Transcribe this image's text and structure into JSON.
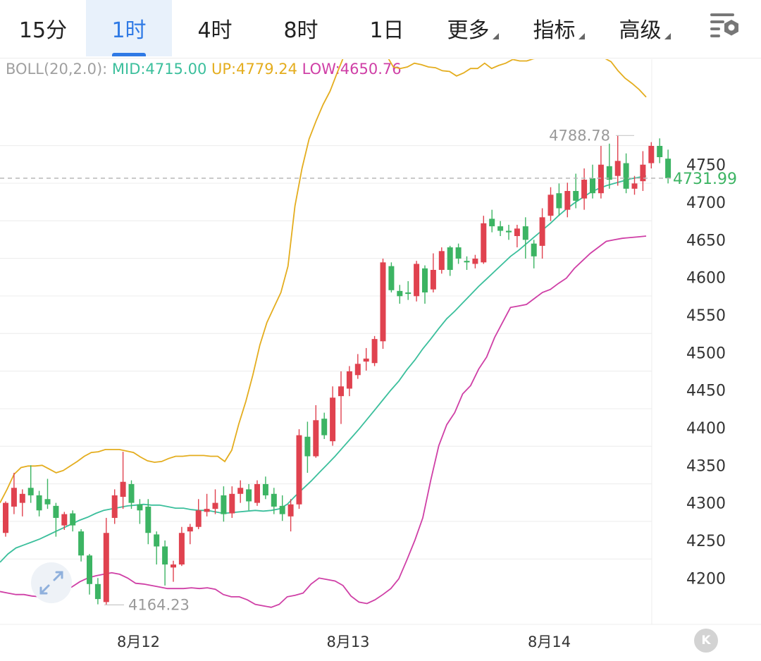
{
  "tabs": [
    {
      "label": "15分",
      "active": false,
      "caret": false
    },
    {
      "label": "1时",
      "active": true,
      "caret": false
    },
    {
      "label": "4时",
      "active": false,
      "caret": false
    },
    {
      "label": "8时",
      "active": false,
      "caret": false
    },
    {
      "label": "1日",
      "active": false,
      "caret": false
    },
    {
      "label": "更多",
      "active": false,
      "caret": true
    },
    {
      "label": "指标",
      "active": false,
      "caret": true
    },
    {
      "label": "高级",
      "active": false,
      "caret": true
    }
  ],
  "settings_icon": "chart-settings-icon",
  "boll": {
    "label": "BOLL(20,2.0):",
    "mid": "MID:4715.00",
    "up": "UP:4779.24",
    "low": "LOW:4650.76"
  },
  "colors": {
    "mid": "#3bbf9c",
    "up": "#e4ad1e",
    "low": "#cf3fa6",
    "rise": "#e0424f",
    "fall": "#3cb463",
    "active_tab": "#2f7ae5",
    "grid": "#ececec",
    "axis_text": "#333333"
  },
  "chart_data": {
    "type": "candlestick",
    "interval": "1时",
    "y_ticks": [
      4200,
      4250,
      4300,
      4350,
      4400,
      4450,
      4500,
      4550,
      4600,
      4650,
      4700,
      4750
    ],
    "ylim": [
      4145,
      4820
    ],
    "x_labels": [
      {
        "label": "8月12",
        "index": 15
      },
      {
        "label": "8月13",
        "index": 40
      },
      {
        "label": "8月14",
        "index": 64
      }
    ],
    "last_price": 4731.99,
    "annotations": {
      "high": 4788.78,
      "low": 4164.23
    },
    "indicators": [
      "BOLL(20,2.0)"
    ],
    "candles": [
      [
        4260,
        4300,
        4255,
        4302
      ],
      [
        4295,
        4320,
        4285,
        4340
      ],
      [
        4300,
        4312,
        4282,
        4318
      ],
      [
        4320,
        4310,
        4300,
        4350
      ],
      [
        4310,
        4290,
        4282,
        4316
      ],
      [
        4305,
        4298,
        4292,
        4332
      ],
      [
        4296,
        4280,
        4255,
        4300
      ],
      [
        4270,
        4285,
        4264,
        4288
      ],
      [
        4286,
        4270,
        4262,
        4290
      ],
      [
        4262,
        4230,
        4222,
        4265
      ],
      [
        4230,
        4192,
        4178,
        4232
      ],
      [
        4192,
        4172,
        4165,
        4200
      ],
      [
        4168,
        4260,
        4164.23,
        4280
      ],
      [
        4280,
        4310,
        4272,
        4318
      ],
      [
        4308,
        4328,
        4292,
        4368
      ],
      [
        4325,
        4300,
        4292,
        4330
      ],
      [
        4298,
        4290,
        4272,
        4305
      ],
      [
        4295,
        4260,
        4245,
        4305
      ],
      [
        4258,
        4242,
        4218,
        4262
      ],
      [
        4242,
        4218,
        4190,
        4250
      ],
      [
        4214,
        4218,
        4195,
        4223
      ],
      [
        4218,
        4260,
        4216,
        4268
      ],
      [
        4262,
        4268,
        4245,
        4272
      ],
      [
        4268,
        4290,
        4265,
        4305
      ],
      [
        4288,
        4292,
        4282,
        4312
      ],
      [
        4292,
        4300,
        4285,
        4318
      ],
      [
        4310,
        4285,
        4275,
        4322
      ],
      [
        4286,
        4312,
        4280,
        4322
      ],
      [
        4312,
        4320,
        4300,
        4330
      ],
      [
        4318,
        4302,
        4290,
        4325
      ],
      [
        4300,
        4325,
        4296,
        4330
      ],
      [
        4325,
        4310,
        4305,
        4335
      ],
      [
        4312,
        4295,
        4285,
        4320
      ],
      [
        4296,
        4285,
        4276,
        4310
      ],
      [
        4282,
        4298,
        4262,
        4305
      ],
      [
        4298,
        4390,
        4292,
        4398
      ],
      [
        4388,
        4362,
        4340,
        4408
      ],
      [
        4362,
        4410,
        4360,
        4430
      ],
      [
        4412,
        4390,
        4385,
        4420
      ],
      [
        4382,
        4440,
        4376,
        4455
      ],
      [
        4442,
        4455,
        4405,
        4475
      ],
      [
        4452,
        4475,
        4442,
        4482
      ],
      [
        4470,
        4485,
        4465,
        4498
      ],
      [
        4488,
        4492,
        4476,
        4506
      ],
      [
        4486,
        4518,
        4482,
        4522
      ],
      [
        4515,
        4620,
        4505,
        4625
      ],
      [
        4615,
        4583,
        4580,
        4620
      ],
      [
        4582,
        4575,
        4565,
        4590
      ],
      [
        4580,
        4578,
        4570,
        4595
      ],
      [
        4575,
        4618,
        4568,
        4622
      ],
      [
        4612,
        4580,
        4565,
        4616
      ],
      [
        4584,
        4610,
        4580,
        4632
      ],
      [
        4610,
        4635,
        4605,
        4640
      ],
      [
        4640,
        4610,
        4602,
        4642
      ],
      [
        4640,
        4625,
        4618,
        4645
      ],
      [
        4622,
        4620,
        4610,
        4628
      ],
      [
        4618,
        4625,
        4612,
        4630
      ],
      [
        4620,
        4672,
        4618,
        4682
      ],
      [
        4678,
        4668,
        4660,
        4690
      ],
      [
        4668,
        4662,
        4655,
        4675
      ],
      [
        4662,
        4660,
        4650,
        4670
      ],
      [
        4655,
        4665,
        4640,
        4670
      ],
      [
        4668,
        4650,
        4625,
        4680
      ],
      [
        4645,
        4628,
        4612,
        4650
      ],
      [
        4642,
        4680,
        4625,
        4692
      ],
      [
        4682,
        4710,
        4675,
        4720
      ],
      [
        4712,
        4692,
        4682,
        4725
      ],
      [
        4690,
        4715,
        4680,
        4726
      ],
      [
        4715,
        4702,
        4692,
        4738
      ],
      [
        4705,
        4730,
        4690,
        4745
      ],
      [
        4732,
        4712,
        4705,
        4750
      ],
      [
        4712,
        4750,
        4705,
        4775
      ],
      [
        4748,
        4730,
        4718,
        4778
      ],
      [
        4735,
        4755,
        4722,
        4788.78
      ],
      [
        4752,
        4718,
        4712,
        4765
      ],
      [
        4718,
        4725,
        4710,
        4735
      ],
      [
        4728,
        4750,
        4715,
        4768
      ],
      [
        4752,
        4775,
        4745,
        4780
      ],
      [
        4775,
        4760,
        4752,
        4785
      ],
      [
        4758,
        4732,
        4725,
        4770
      ]
    ],
    "boll_up": [
      4300,
      4318,
      4338,
      4347,
      4349,
      4349,
      4350,
      4345,
      4340,
      4343,
      4349,
      4355,
      4362,
      4367,
      4368,
      4371,
      4371,
      4371,
      4369,
      4367,
      4361,
      4356,
      4354,
      4355,
      4359,
      4362,
      4362,
      4363,
      4363,
      4363,
      4362,
      4362,
      4355,
      4370,
      4405,
      4435,
      4470,
      4510,
      4540,
      4560,
      4580,
      4615,
      4695,
      4745,
      4784,
      4808,
      4830,
      4848,
      4872,
      4895,
      4912,
      4926,
      4926,
      4922,
      4911,
      4896,
      4880,
      4878,
      4880,
      4885,
      4883,
      4880,
      4879,
      4875,
      4874,
      4868,
      4872,
      4878,
      4878,
      4885,
      4878,
      4882,
      4885,
      4890,
      4888,
      4888,
      4891,
      4892,
      4895,
      4897,
      4898,
      4896,
      4892,
      4892,
      4895,
      4895,
      4892,
      4887,
      4875,
      4865,
      4858,
      4850,
      4840
    ],
    "boll_mid": [
      4221,
      4232,
      4240,
      4244,
      4248,
      4252,
      4257,
      4262,
      4267,
      4272,
      4277,
      4281,
      4286,
      4290,
      4292,
      4294,
      4296,
      4297,
      4298,
      4297,
      4297,
      4295,
      4293,
      4293,
      4291,
      4290,
      4290,
      4288,
      4286,
      4287,
      4288,
      4289,
      4290,
      4289,
      4290,
      4292,
      4298,
      4309,
      4319,
      4329,
      4340,
      4351,
      4362,
      4374,
      4386,
      4398,
      4411,
      4424,
      4437,
      4450,
      4462,
      4477,
      4490,
      4505,
      4518,
      4532,
      4545,
      4555,
      4566,
      4577,
      4588,
      4598,
      4608,
      4618,
      4628,
      4636,
      4645,
      4654,
      4663,
      4672,
      4682,
      4691,
      4699,
      4706,
      4713,
      4718,
      4722,
      4725,
      4728,
      4731,
      4733,
      4735
    ],
    "boll_low": [
      4182,
      4180,
      4178,
      4178,
      4176,
      4175,
      4175,
      4178,
      4184,
      4188,
      4195,
      4200,
      4203,
      4205,
      4207,
      4205,
      4200,
      4193,
      4192,
      4190,
      4188,
      4186,
      4186,
      4186,
      4187,
      4186,
      4187,
      4185,
      4178,
      4175,
      4175,
      4171,
      4165,
      4163,
      4161,
      4165,
      4175,
      4177,
      4180,
      4192,
      4200,
      4198,
      4196,
      4190,
      4176,
      4168,
      4166,
      4171,
      4178,
      4186,
      4199,
      4224,
      4250,
      4280,
      4330,
      4376,
      4404,
      4420,
      4445,
      4456,
      4478,
      4494,
      4520,
      4540,
      4560,
      4562,
      4564,
      4572,
      4580,
      4584,
      4592,
      4599,
      4612,
      4622,
      4632,
      4640,
      4648,
      4650,
      4652,
      4653,
      4654,
      4655
    ]
  }
}
